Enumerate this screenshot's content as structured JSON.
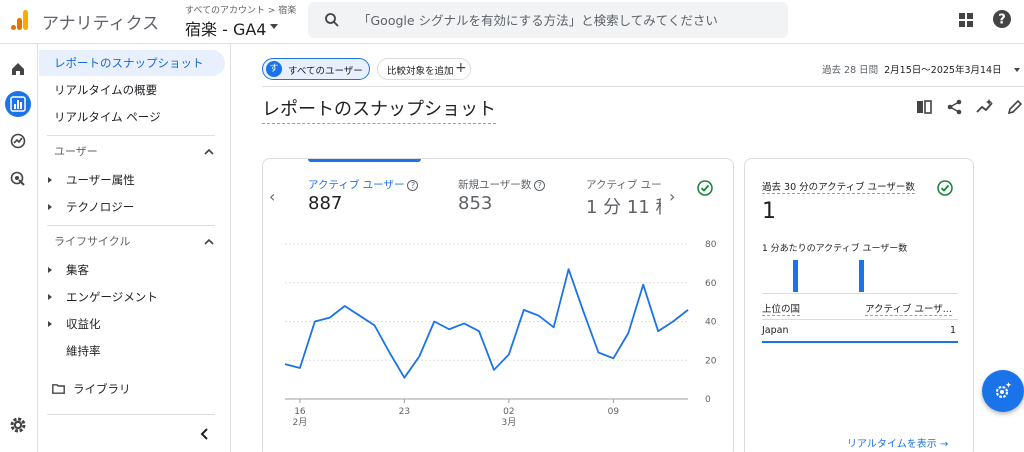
{
  "header": {
    "app_title": "アナリティクス",
    "account_breadcrumb": "すべてのアカウント > 宿楽",
    "property_name": "宿楽 - GA4",
    "search_placeholder": "「Google シグナルを有効にする方法」と検索してみてください"
  },
  "sidebar": {
    "items": [
      {
        "label": "レポートのスナップショット",
        "active": true
      },
      {
        "label": "リアルタイムの概要"
      },
      {
        "label": "リアルタイム ページ"
      }
    ],
    "sections": [
      {
        "label": "ユーザー",
        "items": [
          "ユーザー属性",
          "テクノロジー"
        ]
      },
      {
        "label": "ライフサイクル",
        "items": [
          "集客",
          "エンゲージメント",
          "収益化",
          "維持率"
        ]
      }
    ],
    "library_label": "ライブラリ"
  },
  "toolbar": {
    "segment_avatar": "す",
    "segment_label": "すべてのユーザー",
    "compare_label": "比較対象を追加",
    "date_prefix": "過去 28 日間",
    "date_range": "2月15日～2025年3月14日"
  },
  "page_title": "レポートのスナップショット",
  "metrics": [
    {
      "label": "アクティブ ユーザー",
      "value": "887",
      "active": true
    },
    {
      "label": "新規ユーザー数",
      "value": "853"
    },
    {
      "label": "アクティブ ユー",
      "value": "1 分 11 秒"
    }
  ],
  "chart_data": {
    "type": "line",
    "x_tick_labels": [
      {
        "day": "16",
        "month": "2月"
      },
      {
        "day": "23",
        "month": ""
      },
      {
        "day": "02",
        "month": "3月"
      },
      {
        "day": "09",
        "month": ""
      }
    ],
    "x_ticks_index": [
      1,
      8,
      15,
      22
    ],
    "y_ticks": [
      0,
      20,
      40,
      60,
      80
    ],
    "ylim": [
      0,
      80
    ],
    "series": [
      {
        "values": [
          18,
          16,
          40,
          42,
          48,
          43,
          38,
          24,
          11,
          22,
          40,
          36,
          39,
          35,
          15,
          23,
          46,
          43,
          37,
          67,
          45,
          24,
          21,
          34,
          59,
          35,
          40,
          46
        ]
      }
    ],
    "color": "#1a73e8"
  },
  "realtime": {
    "title": "過去 30 分のアクティブ ユーザー数",
    "value": "1",
    "per_minute_label": "1 分あたりのアクティブ ユーザー数",
    "per_minute_bars": [
      1,
      1
    ],
    "col_country": "上位の国",
    "col_users": "アクティブ ユーザ...",
    "rows": [
      {
        "country": "Japan",
        "users": "1"
      }
    ],
    "link_label": "リアルタイムを表示 →"
  },
  "colors": {
    "accent": "#1a73e8",
    "check": "#188038",
    "logo_orange": "#f9ab00",
    "logo_dark": "#e37400"
  }
}
